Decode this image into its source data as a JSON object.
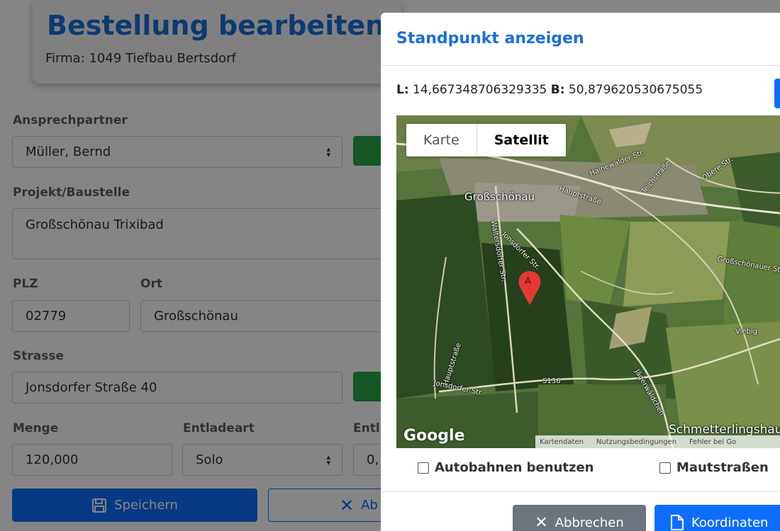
{
  "page": {
    "title": "Bestellung bearbeiten -",
    "subtitle": "Firma: 1049 Tiefbau Bertsdorf"
  },
  "form": {
    "contact_label": "Ansprechpartner",
    "contact_value": "Müller, Bernd",
    "project_label": "Projekt/Baustelle",
    "project_value": "Großschönau Trixibad",
    "zip_label": "PLZ",
    "zip_value": "02779",
    "city_label": "Ort",
    "city_value": "Großschönau",
    "street_label": "Strasse",
    "street_value": "Jonsdorfer Straße 40",
    "quantity_label": "Menge",
    "quantity_value": "120,000",
    "unload_label": "Entladeart",
    "unload_value": "Solo",
    "partial_label": "Entl",
    "partial_value": "0,",
    "save_label": "Speichern",
    "cancel_partial_label": "Ab"
  },
  "modal": {
    "title": "Standpunkt anzeigen",
    "lon_label": "L:",
    "lon_value": "14,667348706329335",
    "lat_label": "B:",
    "lat_value": "50,879620530675055",
    "map_type_map": "Karte",
    "map_type_satellite": "Satellit",
    "marker_letter": "A",
    "google_logo": "Google",
    "attribution": [
      "Kartendaten",
      "Nutzungsbedingungen",
      "Fehler bei Go"
    ],
    "map_labels": {
      "town": "Großschönau",
      "hauptstrasse_top": "Hauptstraße",
      "hainewalder": "Hainewalder Str.",
      "teichstrasse": "Teichstraße",
      "obere": "Obere Str.",
      "waltersdorfer": "Waltersdorfer Str.",
      "jonsdorfer_1": "Jonsdorfer Str.",
      "grossschoenauer": "Großschönauer Str.",
      "viebig": "Viebig",
      "hauptstrasse_left": "Hauptstraße",
      "s136": "S136",
      "jaegerwaeldchen": "Jägerwäldchen",
      "jonsdorfer_2": "Jonsdorfer Str.",
      "schmetterlingshaus": "Schmetterlingshaus"
    },
    "checkbox_highways": "Autobahnen benutzen",
    "checkbox_tolls": "Mautstraßen",
    "cancel_label": "Abbrechen",
    "coords_label": "Koordinaten"
  }
}
